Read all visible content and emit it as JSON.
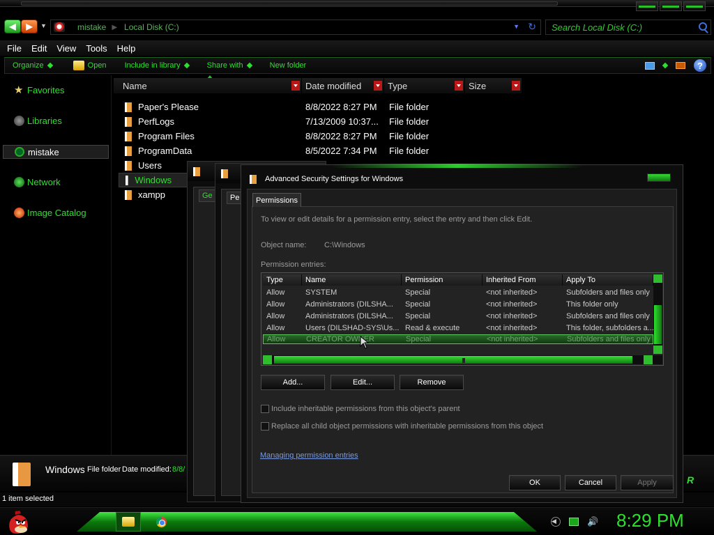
{
  "navigation": {
    "address_crumbs": [
      "mistake",
      "Local Disk (C:)"
    ],
    "search_placeholder": "Search Local Disk (C:)"
  },
  "menu": [
    "File",
    "Edit",
    "View",
    "Tools",
    "Help"
  ],
  "commands": [
    "Organize",
    "Open",
    "Include in library",
    "Share with",
    "New folder"
  ],
  "sidebar": {
    "favorites": "Favorites",
    "libraries": "Libraries",
    "user": "mistake",
    "network": "Network",
    "image_catalog": "Image Catalog"
  },
  "columns": [
    "Name",
    "Date modified",
    "Type",
    "Size"
  ],
  "files": [
    {
      "name": "Paper's Please",
      "date": "8/8/2022 8:27 PM",
      "type": "File folder"
    },
    {
      "name": "PerfLogs",
      "date": "7/13/2009 10:37...",
      "type": "File folder"
    },
    {
      "name": "Program Files",
      "date": "8/8/2022 8:27 PM",
      "type": "File folder"
    },
    {
      "name": "ProgramData",
      "date": "8/5/2022 7:34 PM",
      "type": "File folder"
    },
    {
      "name": "Users",
      "date": "",
      "type": ""
    },
    {
      "name": "Windows",
      "date": "",
      "type": ""
    },
    {
      "name": "xampp",
      "date": "",
      "type": ""
    }
  ],
  "details": {
    "name": "Windows",
    "type": "File folder",
    "date_label": "Date modified:",
    "date_value": "8/8/",
    "brand": "R"
  },
  "status": "1 item selected",
  "bg_dialogs": {
    "tab1": "Ge",
    "tab2": "Pe"
  },
  "dialog": {
    "title": "Advanced Security Settings for Windows",
    "tab": "Permissions",
    "instruction": "To view or edit details for a permission entry, select the entry and then click Edit.",
    "object_name_label": "Object name:",
    "object_name_value": "C:\\Windows",
    "entries_label": "Permission entries:",
    "columns": [
      "Type",
      "Name",
      "Permission",
      "Inherited From",
      "Apply To"
    ],
    "rows": [
      [
        "Allow",
        "SYSTEM",
        "Special",
        "<not inherited>",
        "Subfolders and files only"
      ],
      [
        "Allow",
        "Administrators (DILSHA...",
        "Special",
        "<not inherited>",
        "This folder only"
      ],
      [
        "Allow",
        "Administrators (DILSHA...",
        "Special",
        "<not inherited>",
        "Subfolders and files only"
      ],
      [
        "Allow",
        "Users (DILSHAD-SYS\\Us...",
        "Read & execute",
        "<not inherited>",
        "This folder, subfolders a..."
      ],
      [
        "Allow",
        "CREATOR OWNER",
        "Special",
        "<not inherited>",
        "Subfolders and files only"
      ]
    ],
    "buttons": {
      "add": "Add...",
      "edit": "Edit...",
      "remove": "Remove",
      "ok": "OK",
      "cancel": "Cancel",
      "apply": "Apply"
    },
    "checkbox_inherit": "Include inheritable permissions from this object's parent",
    "checkbox_replace": "Replace all child object permissions with inheritable permissions from this object",
    "link": "Managing permission entries"
  },
  "taskbar": {
    "clock": "8:29 PM"
  }
}
